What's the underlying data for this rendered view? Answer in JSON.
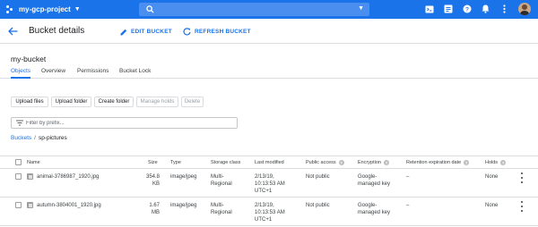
{
  "topbar": {
    "project_name": "my-gcp-project",
    "icons": [
      "cloud-shell-icon",
      "notifications-list-icon",
      "help-icon",
      "bell-icon",
      "more-vert-icon"
    ],
    "brand_color": "#1a73e8"
  },
  "header": {
    "title": "Bucket details",
    "edit_label": "EDIT BUCKET",
    "refresh_label": "REFRESH BUCKET"
  },
  "bucket": {
    "name": "my-bucket"
  },
  "tabs": [
    {
      "label": "Objects",
      "active": true
    },
    {
      "label": "Overview",
      "active": false
    },
    {
      "label": "Permissions",
      "active": false
    },
    {
      "label": "Bucket Lock",
      "active": false
    }
  ],
  "toolbar": {
    "upload_files": "Upload files",
    "upload_folder": "Upload folder",
    "create_folder": "Create folder",
    "manage_holds": "Manage holds",
    "delete": "Delete"
  },
  "filter": {
    "placeholder": "Filter by prefix..."
  },
  "breadcrumb": {
    "root": "Buckets",
    "separator": "/",
    "current": "sp-pictures"
  },
  "table": {
    "columns": {
      "name": "Name",
      "size": "Size",
      "type": "Type",
      "storage_class": "Storage class",
      "last_modified": "Last modified",
      "public_access": "Public access",
      "encryption": "Encryption",
      "retention": "Retention expiration date",
      "holds": "Holds"
    },
    "rows": [
      {
        "name": "animal-3786987_1920.jpg",
        "size_1": "354.8",
        "size_2": "KB",
        "type": "image/jpeg",
        "class_1": "Multi-",
        "class_2": "Regional",
        "mod_1": "2/13/19,",
        "mod_2": "10:13:53 AM",
        "mod_3": "UTC+1",
        "public": "Not public",
        "enc_1": "Google-",
        "enc_2": "managed key",
        "retention": "–",
        "holds": "None"
      },
      {
        "name": "autumn-3804001_1920.jpg",
        "size_1": "1.67",
        "size_2": "MB",
        "type": "image/jpeg",
        "class_1": "Multi-",
        "class_2": "Regional",
        "mod_1": "2/13/19,",
        "mod_2": "10:13:53 AM",
        "mod_3": "UTC+1",
        "public": "Not public",
        "enc_1": "Google-",
        "enc_2": "managed key",
        "retention": "–",
        "holds": "None"
      }
    ]
  }
}
